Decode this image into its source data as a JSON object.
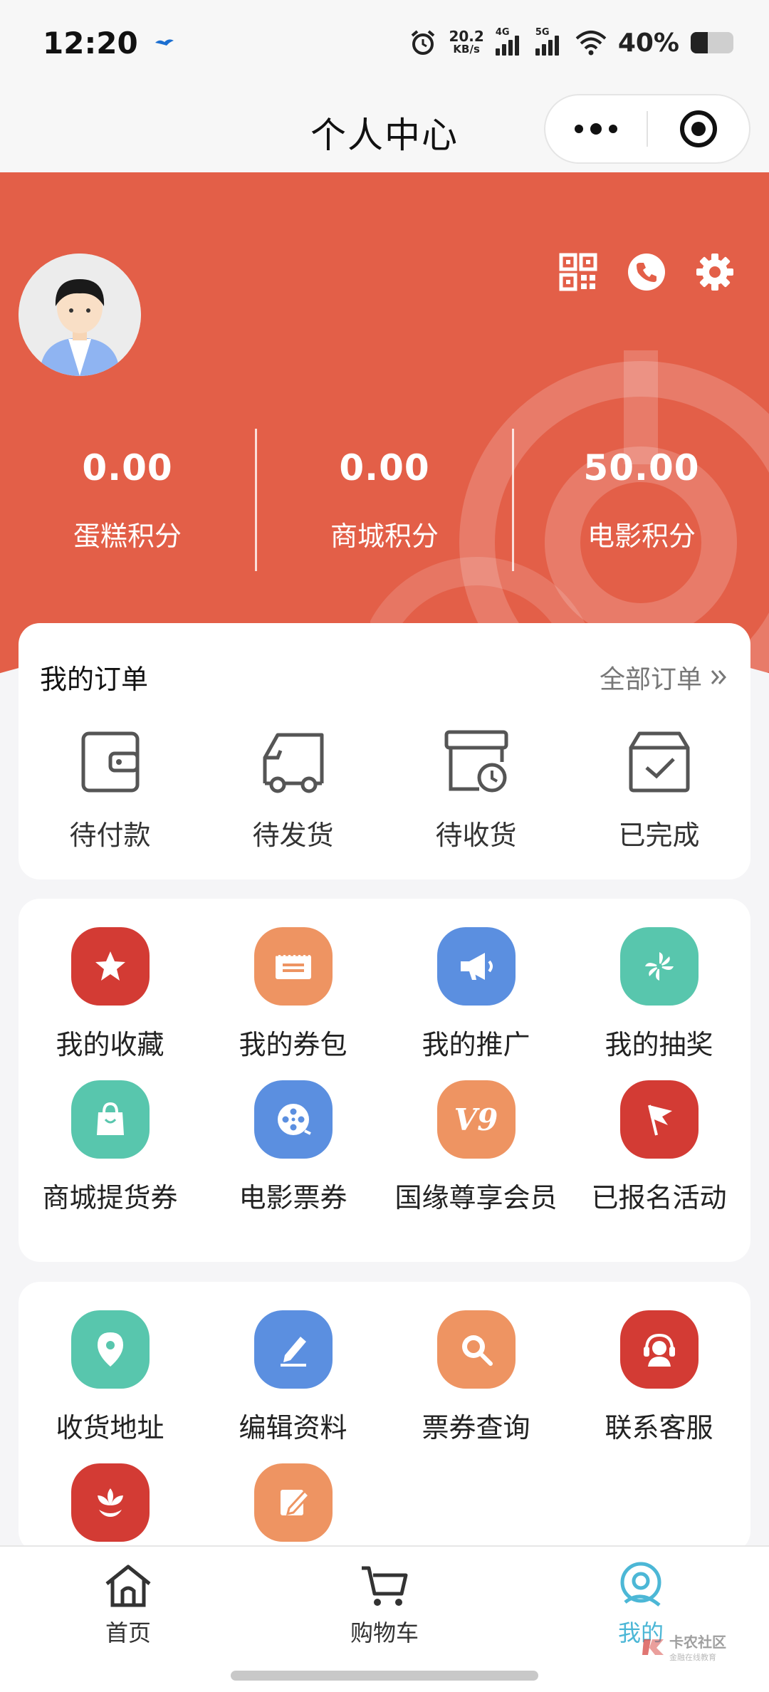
{
  "status_bar": {
    "time": "12:20",
    "net_speed_value": "20.2",
    "net_speed_unit": "KB/s",
    "signal_1": "4G",
    "signal_2": "5G",
    "battery_text": "40%",
    "battery_level": 0.4
  },
  "nav": {
    "title": "个人中心"
  },
  "hero": {
    "accent_color": "#e35f48",
    "points": [
      {
        "value": "0.00",
        "label": "蛋糕积分"
      },
      {
        "value": "0.00",
        "label": "商城积分"
      },
      {
        "value": "50.00",
        "label": "电影积分"
      }
    ]
  },
  "orders": {
    "title": "我的订单",
    "all_label": "全部订单",
    "items": [
      {
        "label": "待付款",
        "icon": "wallet-icon"
      },
      {
        "label": "待发货",
        "icon": "truck-icon"
      },
      {
        "label": "待收货",
        "icon": "box-clock-icon"
      },
      {
        "label": "已完成",
        "icon": "box-check-icon"
      }
    ]
  },
  "services": {
    "items": [
      {
        "label": "我的收藏",
        "icon": "star-icon",
        "color": "#d33b34"
      },
      {
        "label": "我的券包",
        "icon": "ticket-icon",
        "color": "#ee9462"
      },
      {
        "label": "我的推广",
        "icon": "megaphone-icon",
        "color": "#5b8fe0"
      },
      {
        "label": "我的抽奖",
        "icon": "pinwheel-icon",
        "color": "#58c6ad"
      },
      {
        "label": "商城提货券",
        "icon": "shopping-bag-icon",
        "color": "#58c6ad"
      },
      {
        "label": "电影票券",
        "icon": "film-reel-icon",
        "color": "#5b8fe0"
      },
      {
        "label": "国缘尊享会员",
        "icon": "v9-badge-icon",
        "color": "#ee9462",
        "badge_text": "V9"
      },
      {
        "label": "已报名活动",
        "icon": "flag-icon",
        "color": "#d33b34"
      }
    ]
  },
  "tools": {
    "items": [
      {
        "label": "收货地址",
        "icon": "location-pin-icon",
        "color": "#58c6ad"
      },
      {
        "label": "编辑资料",
        "icon": "pen-icon",
        "color": "#5b8fe0"
      },
      {
        "label": "票券查询",
        "icon": "magnifier-icon",
        "color": "#ee9462"
      },
      {
        "label": "联系客服",
        "icon": "headset-icon",
        "color": "#d33b34"
      },
      {
        "label": "",
        "icon": "lotus-icon",
        "color": "#d33b34"
      },
      {
        "label": "",
        "icon": "edit-note-icon",
        "color": "#ee9462"
      }
    ]
  },
  "tab_bar": {
    "tabs": [
      {
        "label": "首页",
        "icon": "home-icon"
      },
      {
        "label": "购物车",
        "icon": "cart-icon"
      },
      {
        "label": "我的",
        "icon": "profile-icon",
        "active": true
      }
    ],
    "watermark": "卡农社区",
    "watermark_sub": "金融在线教育"
  }
}
